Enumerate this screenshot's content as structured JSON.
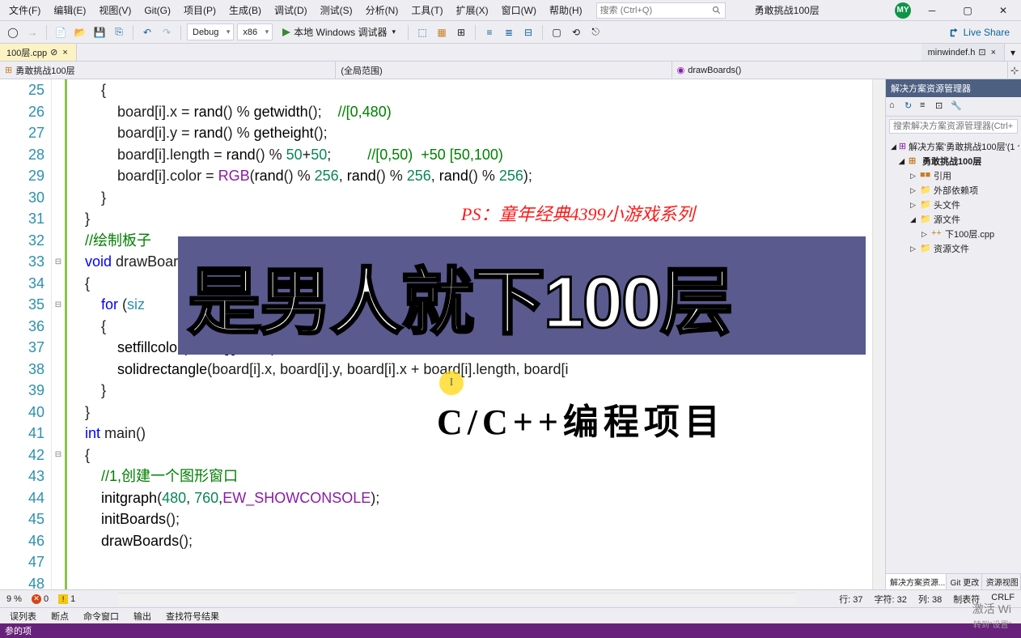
{
  "menus": [
    "文件(F)",
    "编辑(E)",
    "视图(V)",
    "Git(G)",
    "项目(P)",
    "生成(B)",
    "调试(D)",
    "测试(S)",
    "分析(N)",
    "工具(T)",
    "扩展(X)",
    "窗口(W)",
    "帮助(H)"
  ],
  "search_placeholder": "搜索 (Ctrl+Q)",
  "title_tab": "勇敢挑战100层",
  "user_initials": "MY",
  "toolbar": {
    "config": "Debug",
    "platform": "x86",
    "run_label": "本地 Windows 调试器"
  },
  "live_share": "Live Share",
  "doc_tabs": {
    "active": "100层.cpp",
    "pin": "⊘",
    "close": "×",
    "preview": "minwindef.h"
  },
  "nav": {
    "scope1": "勇敢挑战100层",
    "scope2": "(全局范围)",
    "scope3": "drawBoards()"
  },
  "line_numbers": [
    25,
    26,
    27,
    28,
    29,
    30,
    31,
    32,
    33,
    34,
    35,
    36,
    37,
    38,
    39,
    40,
    41,
    42,
    43,
    44,
    45,
    46,
    47,
    48
  ],
  "code_lines": [
    {
      "indent": "        ",
      "tokens": [
        {
          "t": "{",
          "c": ""
        }
      ]
    },
    {
      "indent": "            ",
      "tokens": [
        {
          "t": "board[i].x = ",
          "c": ""
        },
        {
          "t": "rand",
          "c": "fn"
        },
        {
          "t": "() % ",
          "c": ""
        },
        {
          "t": "getwidth",
          "c": "fn"
        },
        {
          "t": "();    ",
          "c": ""
        },
        {
          "t": "//[0,480)",
          "c": "cm"
        }
      ]
    },
    {
      "indent": "            ",
      "tokens": [
        {
          "t": "board[i].y = ",
          "c": ""
        },
        {
          "t": "rand",
          "c": "fn"
        },
        {
          "t": "() % ",
          "c": ""
        },
        {
          "t": "getheight",
          "c": "fn"
        },
        {
          "t": "();",
          "c": ""
        }
      ]
    },
    {
      "indent": "            ",
      "tokens": [
        {
          "t": "board[i].length = ",
          "c": ""
        },
        {
          "t": "rand",
          "c": "fn"
        },
        {
          "t": "() % ",
          "c": ""
        },
        {
          "t": "50",
          "c": "num"
        },
        {
          "t": "+",
          "c": ""
        },
        {
          "t": "50",
          "c": "num"
        },
        {
          "t": ";         ",
          "c": ""
        },
        {
          "t": "//[0,50)  +50 [50,100)",
          "c": "cm"
        }
      ]
    },
    {
      "indent": "            ",
      "tokens": [
        {
          "t": "board[i].color = ",
          "c": ""
        },
        {
          "t": "RGB",
          "c": "mac"
        },
        {
          "t": "(",
          "c": ""
        },
        {
          "t": "rand",
          "c": "fn"
        },
        {
          "t": "() % ",
          "c": ""
        },
        {
          "t": "256",
          "c": "num"
        },
        {
          "t": ", ",
          "c": ""
        },
        {
          "t": "rand",
          "c": "fn"
        },
        {
          "t": "() % ",
          "c": ""
        },
        {
          "t": "256",
          "c": "num"
        },
        {
          "t": ", ",
          "c": ""
        },
        {
          "t": "rand",
          "c": "fn"
        },
        {
          "t": "() % ",
          "c": ""
        },
        {
          "t": "256",
          "c": "num"
        },
        {
          "t": ");",
          "c": ""
        }
      ]
    },
    {
      "indent": "        ",
      "tokens": [
        {
          "t": "}",
          "c": ""
        }
      ]
    },
    {
      "indent": "    ",
      "tokens": [
        {
          "t": "}",
          "c": ""
        }
      ]
    },
    {
      "indent": "    ",
      "tokens": [
        {
          "t": "//绘制板子",
          "c": "cm"
        }
      ]
    },
    {
      "indent": "    ",
      "tokens": [
        {
          "t": "void",
          "c": "kw"
        },
        {
          "t": " drawBoard",
          "c": ""
        }
      ]
    },
    {
      "indent": "    ",
      "tokens": [
        {
          "t": "{",
          "c": ""
        }
      ]
    },
    {
      "indent": "        ",
      "tokens": [
        {
          "t": "for",
          "c": "kw"
        },
        {
          "t": " (",
          "c": ""
        },
        {
          "t": "siz",
          "c": "type"
        }
      ]
    },
    {
      "indent": "        ",
      "tokens": [
        {
          "t": "{",
          "c": ""
        }
      ]
    },
    {
      "indent": "            ",
      "tokens": [
        {
          "t": "setfillcolor(board[i].color);",
          "c": "fn"
        }
      ]
    },
    {
      "indent": "            ",
      "tokens": [
        {
          "t": "solidrectangle",
          "c": "fn"
        },
        {
          "t": "(board[i].x, board[i].y, board[i].x + board[i].length, board[i",
          "c": ""
        }
      ]
    },
    {
      "indent": "        ",
      "tokens": [
        {
          "t": "}",
          "c": ""
        }
      ]
    },
    {
      "indent": "    ",
      "tokens": [
        {
          "t": "}",
          "c": ""
        }
      ]
    },
    {
      "indent": "",
      "tokens": [
        {
          "t": "",
          "c": ""
        }
      ]
    },
    {
      "indent": "    ",
      "tokens": [
        {
          "t": "int",
          "c": "kw"
        },
        {
          "t": " main()",
          "c": ""
        }
      ]
    },
    {
      "indent": "    ",
      "tokens": [
        {
          "t": "{",
          "c": ""
        }
      ]
    },
    {
      "indent": "        ",
      "tokens": [
        {
          "t": "//1,创建一个图形窗口",
          "c": "cm"
        }
      ]
    },
    {
      "indent": "        ",
      "tokens": [
        {
          "t": "initgraph",
          "c": "fn"
        },
        {
          "t": "(",
          "c": ""
        },
        {
          "t": "480",
          "c": "num"
        },
        {
          "t": ", ",
          "c": ""
        },
        {
          "t": "760",
          "c": "num"
        },
        {
          "t": ",",
          "c": ""
        },
        {
          "t": "EW_SHOWCONSOLE",
          "c": "mac"
        },
        {
          "t": ");",
          "c": ""
        }
      ]
    },
    {
      "indent": "        ",
      "tokens": [
        {
          "t": "initBoards",
          "c": "fn"
        },
        {
          "t": "();",
          "c": ""
        }
      ]
    },
    {
      "indent": "        ",
      "tokens": [
        {
          "t": "drawBoards",
          "c": "fn"
        },
        {
          "t": "();",
          "c": ""
        }
      ]
    },
    {
      "indent": "",
      "tokens": [
        {
          "t": "",
          "c": ""
        }
      ]
    }
  ],
  "fold_markers": {
    "33": "⊟",
    "35": "⊟",
    "42": "⊟"
  },
  "solution": {
    "title": "解决方案资源管理器",
    "search_placeholder": "搜索解决方案资源管理器(Ctrl+;)",
    "root": "解决方案'勇敢挑战100层'(1 个项",
    "project": "勇敢挑战100层",
    "items": [
      {
        "label": "引用",
        "icon": "■■"
      },
      {
        "label": "外部依赖项",
        "icon": "📁"
      },
      {
        "label": "头文件",
        "icon": "📁"
      },
      {
        "label": "源文件",
        "icon": "📁",
        "expanded": true
      },
      {
        "label": "下100层.cpp",
        "icon": "++",
        "level": 3
      },
      {
        "label": "资源文件",
        "icon": "📁"
      }
    ],
    "tabs": [
      "解决方案资源...",
      "Git 更改",
      "资源视图"
    ]
  },
  "status": {
    "pct": "9 %",
    "errors": "0",
    "warnings": "1",
    "line": "行: 37",
    "char": "字符: 32",
    "col": "列: 38",
    "tabs": "制表符",
    "enc": "CRLF"
  },
  "bottom_tabs": [
    "误列表",
    "断点",
    "命令窗口",
    "输出",
    "查找符号结果"
  ],
  "footer_text": "参的项",
  "watermark": {
    "line1": "激活 Wi",
    "line2": "转到\"设置\""
  },
  "overlay": {
    "red": "PS：童年经典4399小游戏系列",
    "banner": "是男人就下100层",
    "sub": "C/C++编程项目"
  }
}
